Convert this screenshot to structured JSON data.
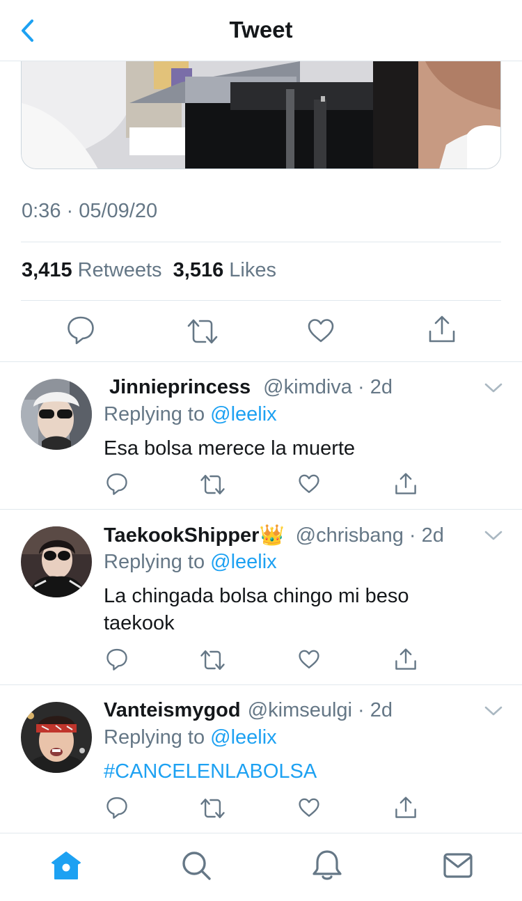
{
  "header": {
    "title": "Tweet",
    "back_icon": "chevron-left-icon"
  },
  "colors": {
    "accent": "#1da1f2",
    "secondary_text": "#657786",
    "primary_text": "#14171a",
    "divider": "#e1e8ed"
  },
  "tweet": {
    "timestamp": "0:36 · 05/09/20",
    "retweets_count": "3,415",
    "retweets_label": "Retweets",
    "likes_count": "3,516",
    "likes_label": "Likes",
    "actions": [
      "reply-icon",
      "retweet-icon",
      "like-icon",
      "share-icon"
    ]
  },
  "replies": [
    {
      "name": "Jinnieprincess",
      "handle": "@kimdiva",
      "time": "2d",
      "replying_prefix": "Replying to",
      "replying_to": "@leelix",
      "text": "Esa bolsa merece la muerte"
    },
    {
      "name": "TaekookShipper👑",
      "handle": "@chrisbang",
      "time": "2d",
      "replying_prefix": "Replying to",
      "replying_to": "@leelix",
      "text": "La chingada bolsa chingo mi beso taekook"
    },
    {
      "name": "Vanteismygod",
      "handle": "@kimseulgi",
      "time": "2d",
      "replying_prefix": "Replying to",
      "replying_to": "@leelix",
      "text": "#CANCELENLABOLSA"
    }
  ],
  "tabbar": {
    "items": [
      "home-icon",
      "search-icon",
      "notifications-icon",
      "messages-icon"
    ],
    "active": "home-icon"
  }
}
